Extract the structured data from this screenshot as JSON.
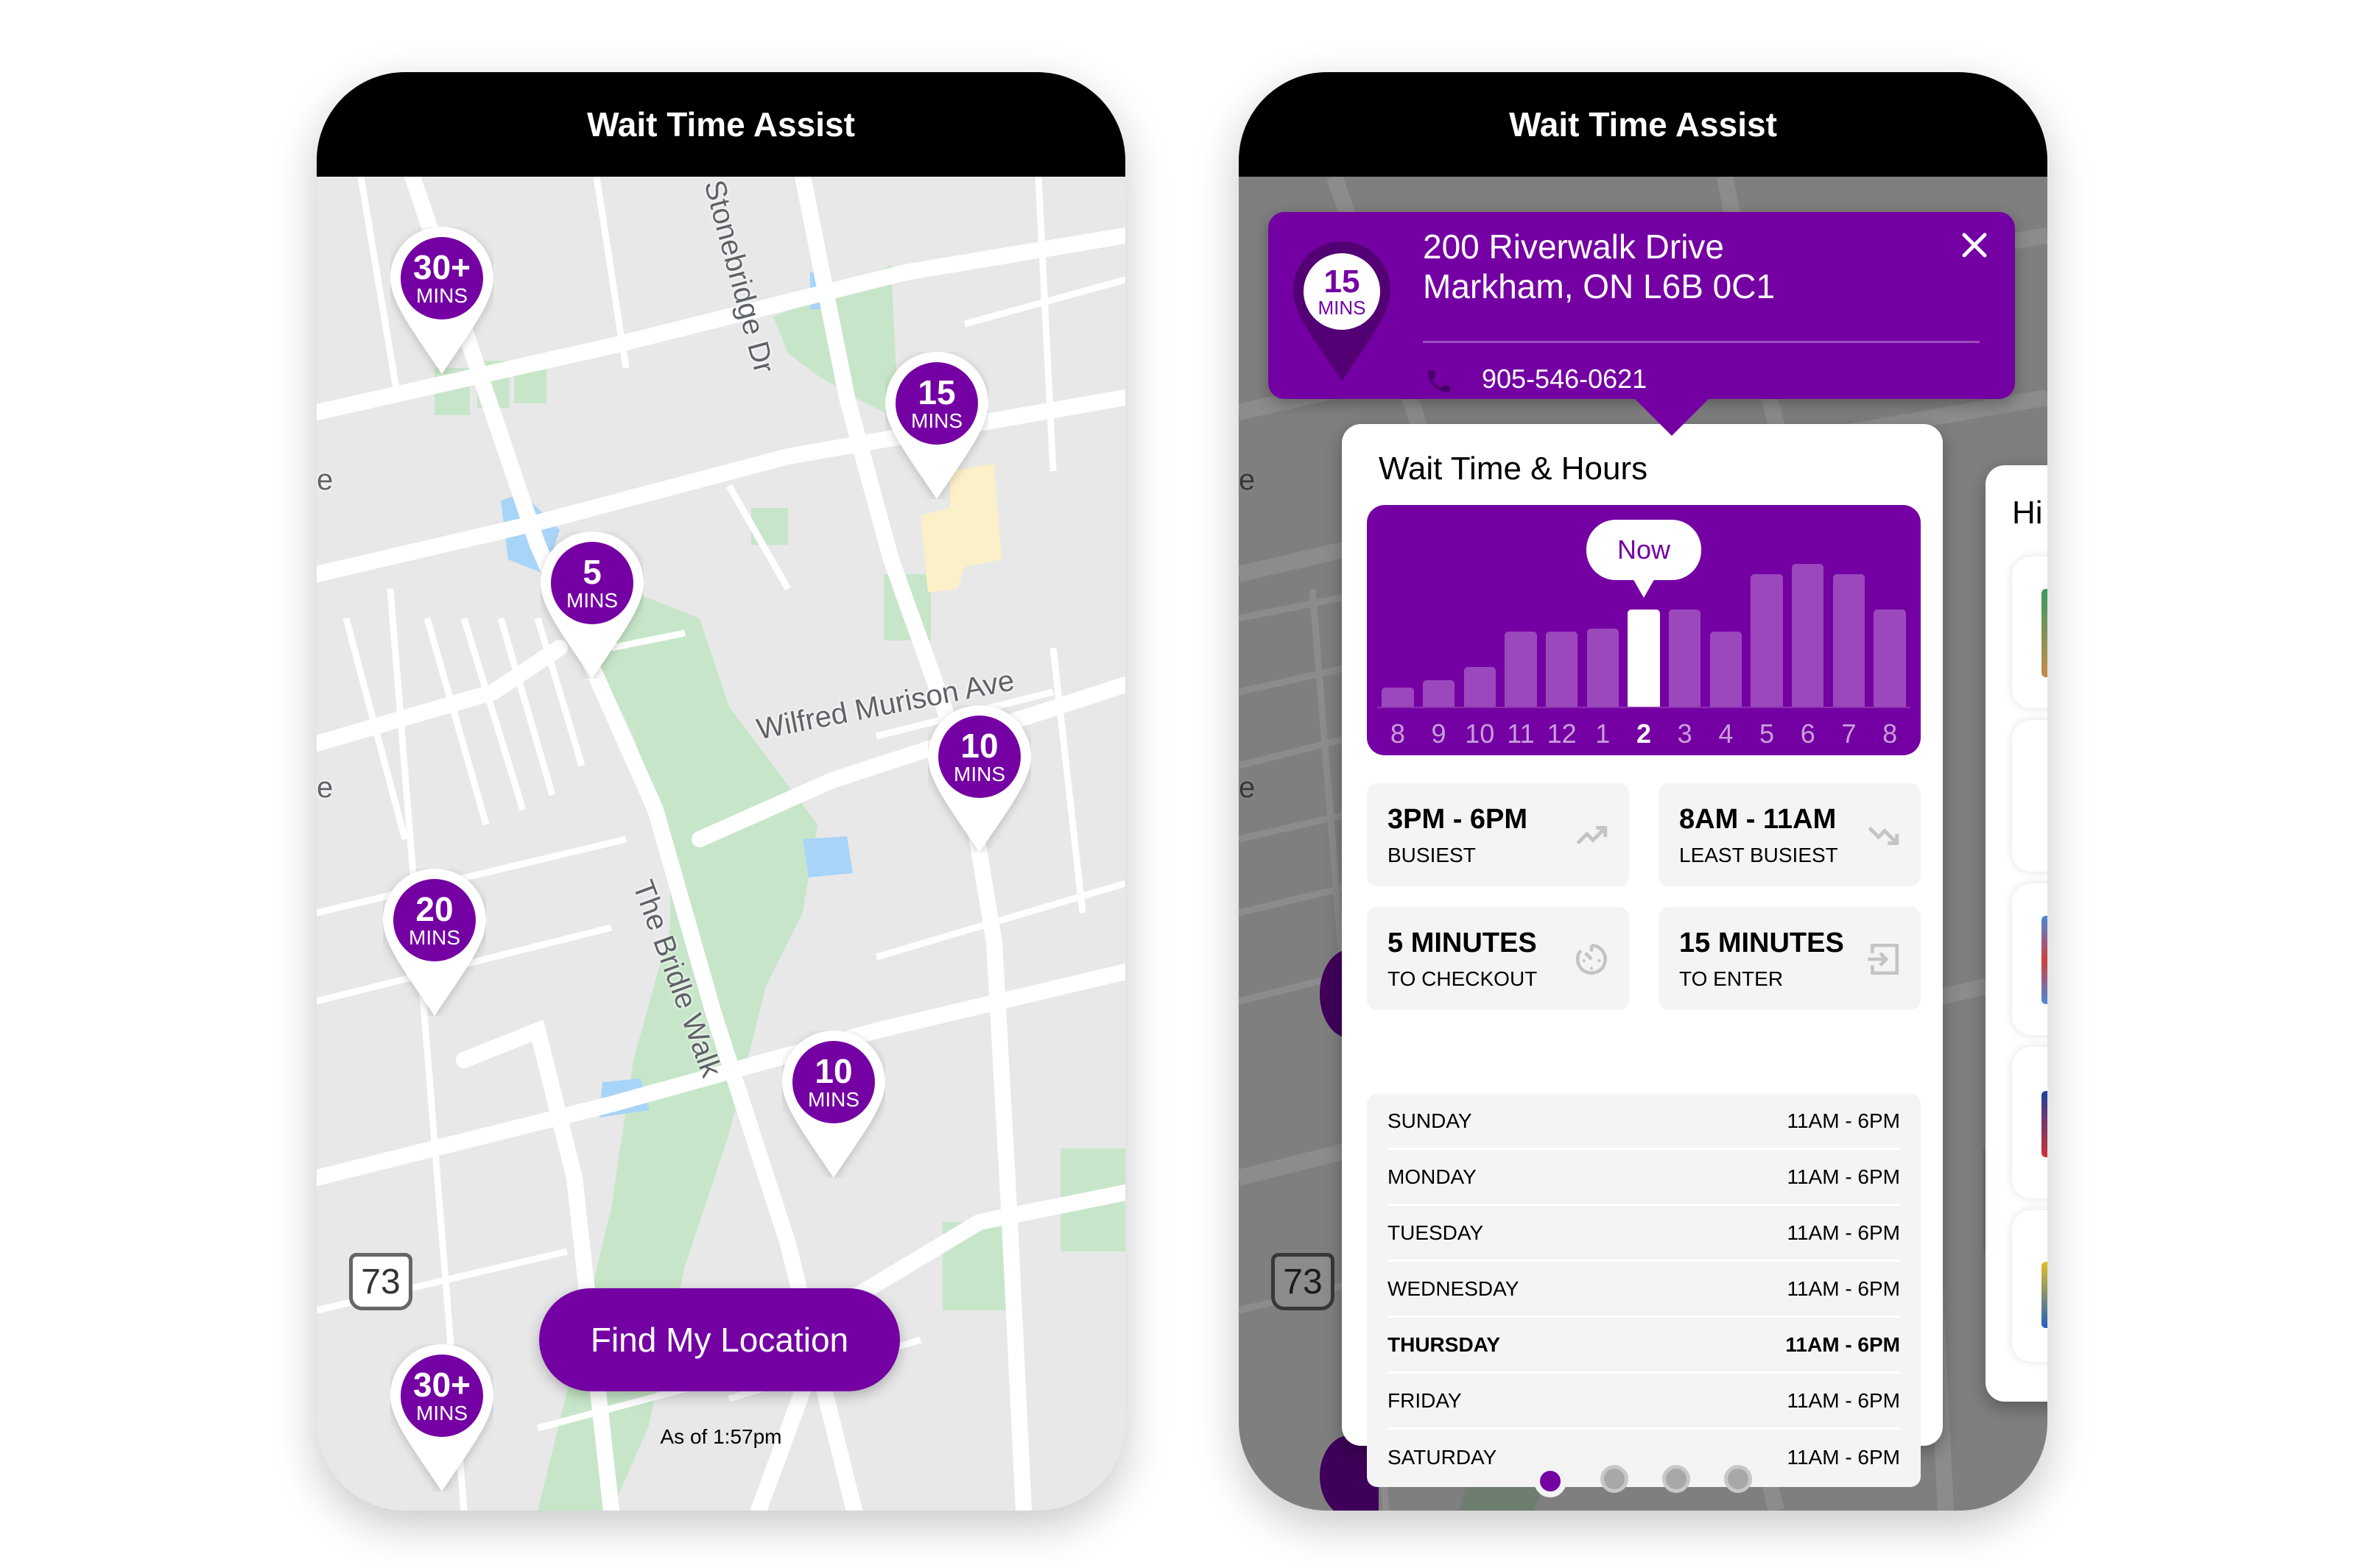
{
  "brand": {
    "accent": "#7400a3",
    "header_bg": "#000000"
  },
  "phone1": {
    "header": {
      "title": "Wait Time Assist"
    },
    "map": {
      "street_labels": [
        "Stonebridge Dr",
        "Wilfred Murison Ave",
        "The Bridle Walk"
      ],
      "route_shield": "73",
      "edge_letters": [
        "e",
        "e"
      ]
    },
    "pins": [
      {
        "value": "30+",
        "unit": "MINS"
      },
      {
        "value": "15",
        "unit": "MINS"
      },
      {
        "value": "5",
        "unit": "MINS"
      },
      {
        "value": "10",
        "unit": "MINS"
      },
      {
        "value": "20",
        "unit": "MINS"
      },
      {
        "value": "10",
        "unit": "MINS"
      },
      {
        "value": "30+",
        "unit": "MINS"
      }
    ],
    "find_location_label": "Find My Location",
    "as_of": "As of 1:57pm"
  },
  "phone2": {
    "header": {
      "title": "Wait Time Assist"
    },
    "route_shield": "73",
    "store": {
      "wait_value": "15",
      "wait_unit": "MINS",
      "address_line1": "200 Riverwalk Drive",
      "address_line2": "Markham, ON  L6B 0C1",
      "phone": "905-546-0621",
      "close_icon": "close-icon",
      "phone_icon": "phone-icon"
    },
    "wait_card": {
      "title": "Wait Time & Hours",
      "now_label": "Now",
      "tiles": [
        {
          "main": "3PM - 6PM",
          "sub": "BUSIEST",
          "icon": "trending-up-icon"
        },
        {
          "main": "8AM - 11AM",
          "sub": "LEAST BUSIEST",
          "icon": "trending-down-icon"
        },
        {
          "main": "5 MINUTES",
          "sub": "TO CHECKOUT",
          "icon": "timer-icon"
        },
        {
          "main": "15 MINUTES",
          "sub": "TO ENTER",
          "icon": "enter-icon"
        }
      ],
      "hours": [
        {
          "day": "SUNDAY",
          "time": "11AM - 6PM",
          "today": false
        },
        {
          "day": "MONDAY",
          "time": "11AM - 6PM",
          "today": false
        },
        {
          "day": "TUESDAY",
          "time": "11AM - 6PM",
          "today": false
        },
        {
          "day": "WEDNESDAY",
          "time": "11AM - 6PM",
          "today": false
        },
        {
          "day": "THURSDAY",
          "time": "11AM - 6PM",
          "today": true
        },
        {
          "day": "FRIDAY",
          "time": "11AM - 6PM",
          "today": false
        },
        {
          "day": "SATURDAY",
          "time": "11AM - 6PM",
          "today": false
        }
      ]
    },
    "side_card": {
      "title_partial": "Hi"
    },
    "pager": {
      "count": 4,
      "active_index": 0
    }
  },
  "chart_data": {
    "type": "bar",
    "title": "Wait Time & Hours",
    "categories": [
      "8",
      "9",
      "10",
      "11",
      "12",
      "1",
      "2",
      "3",
      "4",
      "5",
      "6",
      "7",
      "8"
    ],
    "values": [
      13,
      18,
      27,
      51,
      51,
      53,
      66,
      66,
      51,
      90,
      97,
      90,
      66
    ],
    "current_index": 6,
    "annotation": "Now",
    "ylim": [
      0,
      100
    ],
    "xlabel": "",
    "ylabel": "",
    "grid": false
  }
}
